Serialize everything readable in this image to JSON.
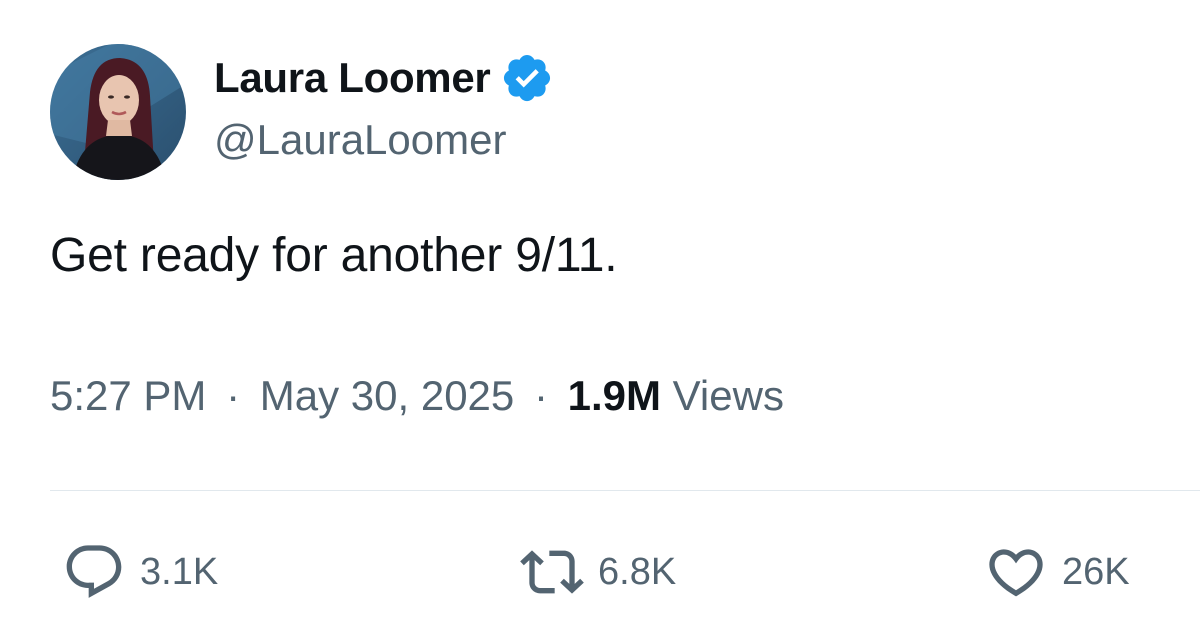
{
  "author": {
    "display_name": "Laura Loomer",
    "handle": "@LauraLoomer",
    "verified": true,
    "verified_color": "#1d9bf0"
  },
  "tweet": {
    "text": "Get ready for another 9/11."
  },
  "meta": {
    "time": "5:27 PM",
    "separator": "·",
    "date": "May 30, 2025",
    "views_count": "1.9M",
    "views_label": "Views"
  },
  "actions": {
    "replies": "3.1K",
    "retweets": "6.8K",
    "likes": "26K"
  },
  "icons": {
    "reply": "reply-bubble-icon",
    "retweet": "retweet-icon",
    "like": "heart-icon",
    "verified": "verified-badge-icon"
  }
}
